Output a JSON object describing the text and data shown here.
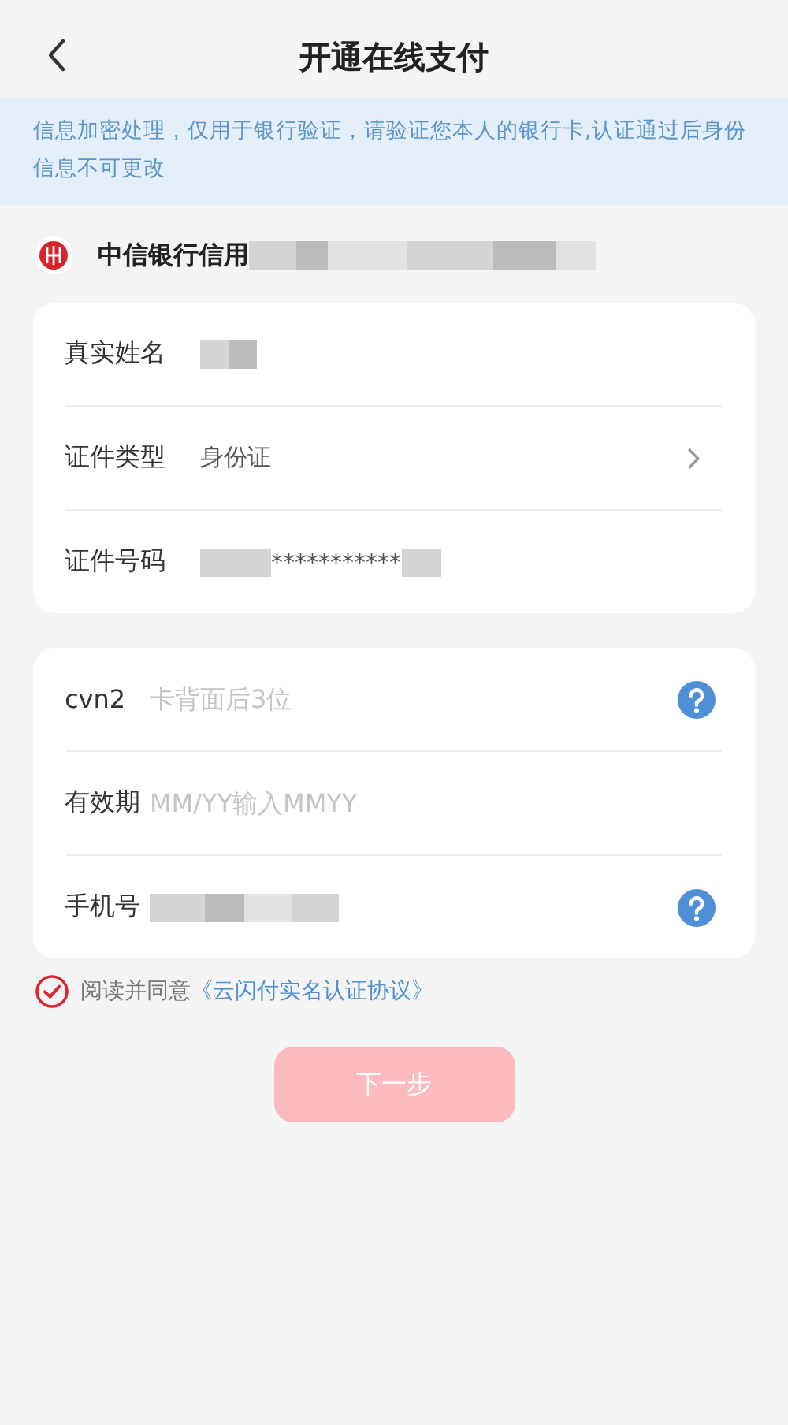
{
  "nav_bar": {
    "title": "开通在线支付"
  },
  "notice": "信息加密处理，仅用于银行验证，请验证您本人的银行卡,认证通过后身份信息不可更改",
  "bank": {
    "name": "中信银行信用"
  },
  "identity_card": {
    "rows": [
      {
        "kind": "redacted",
        "label": "真实姓名"
      },
      {
        "kind": "select",
        "label": "证件类型",
        "value": "身份证"
      },
      {
        "kind": "masked",
        "label": "证件号码",
        "value": "***********"
      }
    ]
  },
  "card_info": {
    "rows": [
      {
        "kind": "input",
        "label": "cvn2",
        "placeholder": "卡背面后3位",
        "help": true
      },
      {
        "kind": "input",
        "label": "有效期",
        "placeholder": "MM/YY输入MMYY",
        "help": false
      },
      {
        "kind": "redacted",
        "label": "手机号",
        "help": true
      }
    ]
  },
  "agreement": {
    "checked": true,
    "text": "阅读并同意",
    "link": "《云闪付实名认证协议》"
  },
  "next_button": {
    "label": "下一步",
    "disabled": true
  }
}
